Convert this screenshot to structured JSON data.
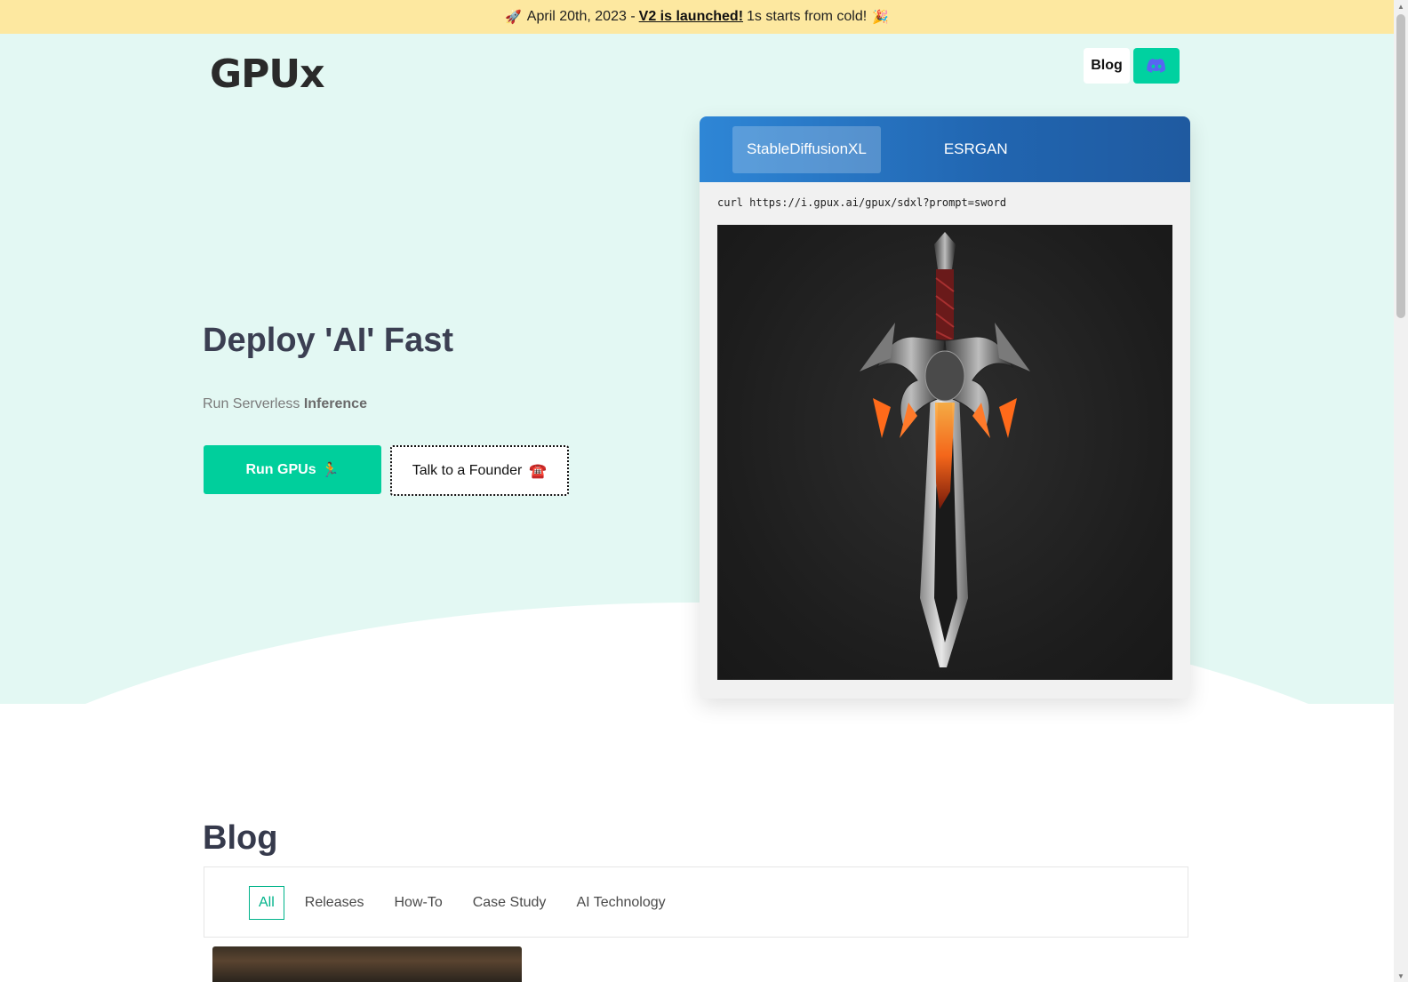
{
  "announcement": {
    "rocket_emoji": "🚀",
    "date": "April 20th, 2023 -",
    "link_text": "V2 is launched!",
    "tail": "1s starts from cold!",
    "party_emoji": "🎉"
  },
  "header": {
    "logo": "GPUx",
    "blog_label": "Blog",
    "discord_icon": "discord-icon"
  },
  "hero": {
    "title": "Deploy 'AI' Fast",
    "subtitle_prefix": "Run Serverless",
    "subtitle_bold": "Inference",
    "primary_button": "Run GPUs",
    "primary_emoji": "🏃",
    "secondary_button": "Talk to a Founder",
    "secondary_emoji": "☎️"
  },
  "demo": {
    "tabs": [
      {
        "label": "StableDiffusionXL",
        "active": true
      },
      {
        "label": "ESRGAN",
        "active": false
      }
    ],
    "command": "curl https://i.gpux.ai/gpux/sdxl?prompt=sword",
    "image_subject": "sword"
  },
  "blog": {
    "title": "Blog",
    "filters": [
      {
        "label": "All",
        "active": true
      },
      {
        "label": "Releases",
        "active": false
      },
      {
        "label": "How-To",
        "active": false
      },
      {
        "label": "Case Study",
        "active": false
      },
      {
        "label": "AI Technology",
        "active": false
      }
    ]
  },
  "colors": {
    "accent": "#00cf9c",
    "announce_bg": "#fde8a0",
    "hero_bg": "#e3f8f3",
    "demo_header": "#2165b0"
  }
}
